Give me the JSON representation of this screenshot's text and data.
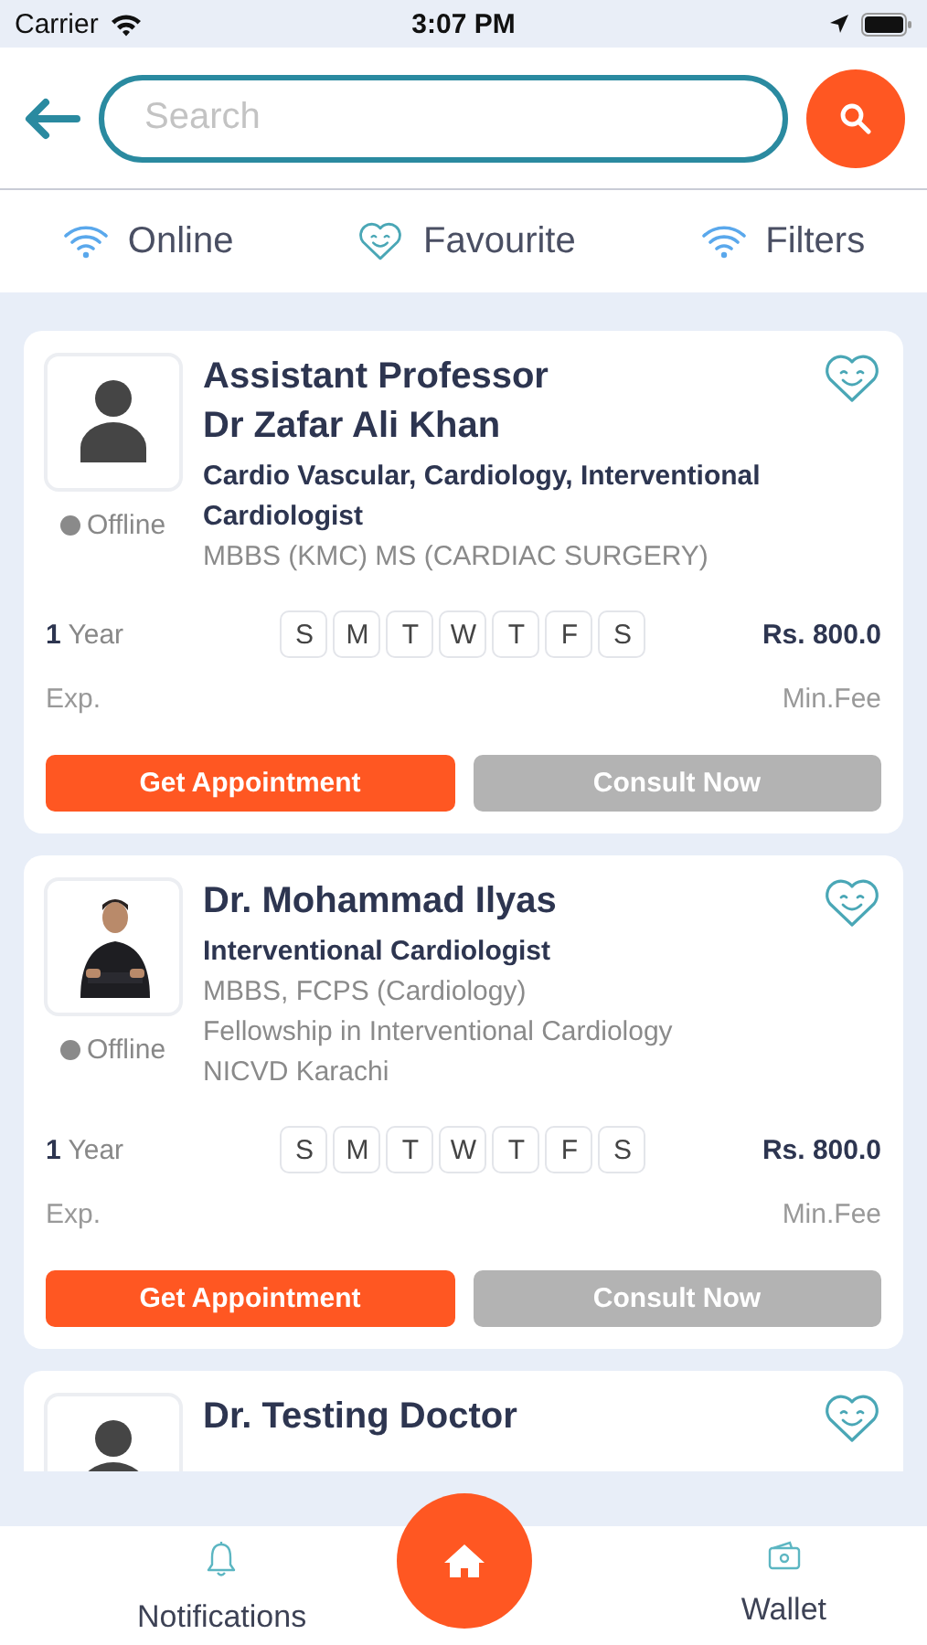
{
  "status_bar": {
    "carrier": "Carrier",
    "time": "3:07 PM"
  },
  "search": {
    "placeholder": "Search"
  },
  "filters": [
    {
      "label": "Online",
      "kind": "wifi"
    },
    {
      "label": "Favourite",
      "kind": "heart"
    },
    {
      "label": "Filters",
      "kind": "wifi"
    }
  ],
  "doctors": [
    {
      "name_lines": [
        "Assistant Professor",
        "Dr Zafar Ali Khan"
      ],
      "specialty": "Cardio Vascular, Cardiology, Interventional Cardiologist",
      "details": [
        "MBBS (KMC) MS (CARDIAC SURGERY)"
      ],
      "kind": "placeholder",
      "status": "Offline",
      "experience_value": "1",
      "experience_unit": "Year",
      "experience_label": "Exp.",
      "days": [
        "S",
        "M",
        "T",
        "W",
        "T",
        "F",
        "S"
      ],
      "fee": "Rs. 800.0",
      "fee_label": "Min.Fee",
      "appointment": "Get Appointment",
      "consult": "Consult Now"
    },
    {
      "name_lines": [
        "Dr. Mohammad Ilyas"
      ],
      "specialty": "Interventional Cardiologist",
      "details": [
        "MBBS, FCPS (Cardiology)",
        "Fellowship in Interventional Cardiology",
        "NICVD Karachi"
      ],
      "status": "Offline",
      "experience_value": "1",
      "experience_unit": "Year",
      "experience_label": "Exp.",
      "days": [
        "S",
        "M",
        "T",
        "W",
        "T",
        "F",
        "S"
      ],
      "fee": "Rs. 800.0",
      "fee_label": "Min.Fee",
      "appointment": "Get Appointment",
      "consult": "Consult Now"
    },
    {
      "name_lines": [
        "Dr. Testing Doctor"
      ],
      "kind": "placeholder"
    }
  ],
  "nav": [
    {
      "label": "Notifications",
      "kind": "bell"
    },
    {
      "label": "Wallet",
      "kind": "wallet"
    }
  ]
}
